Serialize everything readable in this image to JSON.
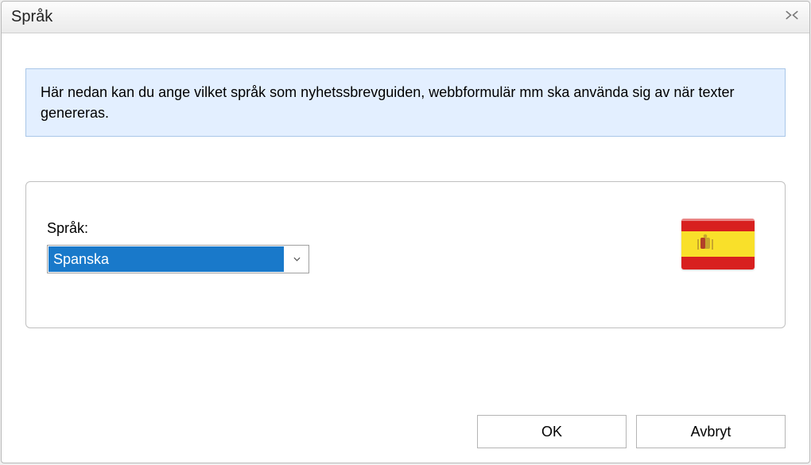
{
  "window": {
    "title": "Språk"
  },
  "info": {
    "text": "Här nedan kan du ange vilket språk som nyhetssbrevguiden, webbformulär mm ska använda sig av när texter genereras."
  },
  "field": {
    "label": "Språk:",
    "selected": "Spanska",
    "flag_country": "spain"
  },
  "buttons": {
    "ok": "OK",
    "cancel": "Avbryt"
  }
}
